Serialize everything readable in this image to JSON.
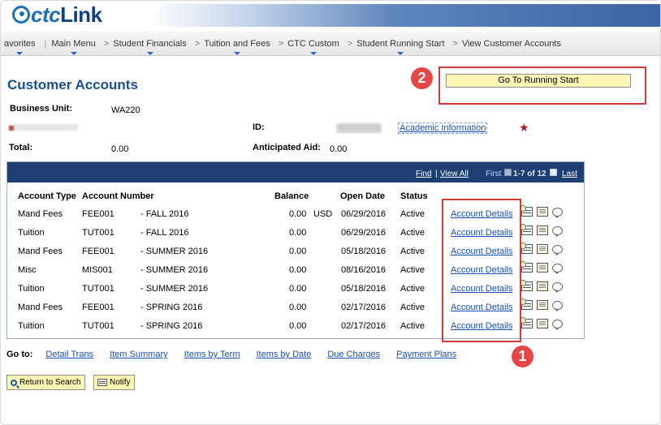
{
  "header": {
    "logo_ctc": "ctc",
    "logo_link": "Link"
  },
  "nav": {
    "favorites": "avorites",
    "main_menu": "Main Menu",
    "student_financials": "Student Financials",
    "tuition_fees": "Tuition and Fees",
    "ctc_custom": "CTC Custom",
    "student_running_start": "Student Running Start",
    "view_customer_accounts": "View Customer Accounts",
    "separator": ">"
  },
  "page": {
    "title": "Customer Accounts"
  },
  "actions": {
    "go_running_start": "Go To Running Start"
  },
  "callouts": {
    "one": "1",
    "two": "2"
  },
  "info": {
    "business_unit_label": "Business Unit:",
    "business_unit_value": "WA220",
    "id_label": "ID:",
    "academic_info": "Academic Information",
    "total_label": "Total:",
    "total_value": "0.00",
    "anticipated_aid_label": "Anticipated Aid:",
    "anticipated_aid_value": "0.00",
    "star": "★"
  },
  "grid": {
    "find": "Find",
    "view_all": "View All",
    "first": "First",
    "count": "1-7 of 12",
    "last": "Last",
    "columns": [
      "Account Type",
      "Account Number",
      "Balance",
      "Open Date",
      "Status"
    ],
    "rows": [
      {
        "type": "Mand Fees",
        "acct": "FEE001",
        "term": "- FALL 2016",
        "balance": "0.00",
        "currency": "USD",
        "open_date": "06/29/2016",
        "status": "Active",
        "details": "Account Details"
      },
      {
        "type": "Tuition",
        "acct": "TUT001",
        "term": "- FALL 2016",
        "balance": "0.00",
        "currency": "",
        "open_date": "06/29/2016",
        "status": "Active",
        "details": "Account Details"
      },
      {
        "type": "Mand Fees",
        "acct": "FEE001",
        "term": "- SUMMER 2016",
        "balance": "0.00",
        "currency": "",
        "open_date": "05/18/2016",
        "status": "Active",
        "details": "Account Details"
      },
      {
        "type": "Misc",
        "acct": "MIS001",
        "term": "- SUMMER 2016",
        "balance": "0.00",
        "currency": "",
        "open_date": "08/16/2016",
        "status": "Active",
        "details": "Account Details"
      },
      {
        "type": "Tuition",
        "acct": "TUT001",
        "term": "- SUMMER 2016",
        "balance": "0.00",
        "currency": "",
        "open_date": "05/18/2016",
        "status": "Active",
        "details": "Account Details"
      },
      {
        "type": "Mand Fees",
        "acct": "FEE001",
        "term": "- SPRING 2016",
        "balance": "0.00",
        "currency": "",
        "open_date": "02/17/2016",
        "status": "Active",
        "details": "Account Details"
      },
      {
        "type": "Tuition",
        "acct": "TUT001",
        "term": "- SPRING 2016",
        "balance": "0.00",
        "currency": "",
        "open_date": "02/17/2016",
        "status": "Active",
        "details": "Account Details"
      }
    ]
  },
  "goto": {
    "label": "Go to:",
    "links": [
      "Detail Trans",
      "Item Summary",
      "Items by Term",
      "Items by Date",
      "Due Charges",
      "Payment Plans"
    ]
  },
  "buttons": {
    "return_search": "Return to Search",
    "notify": "Notify"
  },
  "colors": {
    "accent": "#1a4f91",
    "link": "#1a4fb5",
    "callout": "#d43a3a",
    "button": "#fbf6b6",
    "grid_header": "#1e3f74"
  }
}
